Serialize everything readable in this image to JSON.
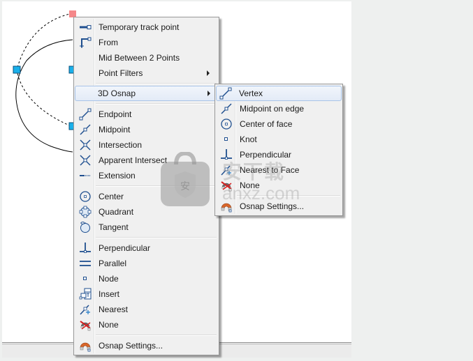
{
  "colors": {
    "menu_bg": "#f0f0f0",
    "icon_blue": "#1f4f8f",
    "grip_cyan": "#1ab0ea",
    "grip_selected": "#f5888a",
    "highlight_border": "#a8c4e8"
  },
  "main_menu": {
    "items": [
      {
        "label": "Temporary track point",
        "icon": "temporary-track-point-icon"
      },
      {
        "label": "From",
        "icon": "from-icon"
      },
      {
        "label": "Mid Between 2 Points",
        "icon": ""
      },
      {
        "label": "Point Filters",
        "icon": "",
        "submenu": true
      },
      {
        "label": "3D Osnap",
        "icon": "",
        "submenu": true,
        "highlighted": true
      },
      {
        "label": "Endpoint",
        "icon": "endpoint-icon"
      },
      {
        "label": "Midpoint",
        "icon": "midpoint-icon"
      },
      {
        "label": "Intersection",
        "icon": "intersection-icon"
      },
      {
        "label": "Apparent Intersect",
        "icon": "apparent-intersect-icon"
      },
      {
        "label": "Extension",
        "icon": "extension-icon"
      },
      {
        "label": "Center",
        "icon": "center-icon"
      },
      {
        "label": "Quadrant",
        "icon": "quadrant-icon"
      },
      {
        "label": "Tangent",
        "icon": "tangent-icon"
      },
      {
        "label": "Perpendicular",
        "icon": "perpendicular-icon"
      },
      {
        "label": "Parallel",
        "icon": "parallel-icon"
      },
      {
        "label": "Node",
        "icon": "node-icon"
      },
      {
        "label": "Insert",
        "icon": "insert-icon"
      },
      {
        "label": "Nearest",
        "icon": "nearest-icon"
      },
      {
        "label": "None",
        "icon": "none-icon"
      },
      {
        "label": "Osnap Settings...",
        "icon": "osnap-settings-icon"
      }
    ]
  },
  "submenu_3d_osnap": {
    "items": [
      {
        "label": "Vertex",
        "icon": "vertex-icon",
        "highlighted": true
      },
      {
        "label": "Midpoint on edge",
        "icon": "midpoint-on-edge-icon"
      },
      {
        "label": "Center of face",
        "icon": "center-of-face-icon"
      },
      {
        "label": "Knot",
        "icon": "knot-icon"
      },
      {
        "label": "Perpendicular",
        "icon": "perpendicular-icon"
      },
      {
        "label": "Nearest to Face",
        "icon": "nearest-to-face-icon"
      },
      {
        "label": "None",
        "icon": "none-icon"
      },
      {
        "label": "Osnap Settings...",
        "icon": "osnap-settings-icon"
      }
    ]
  },
  "watermark": {
    "text": "安下载",
    "sub": "anxz.com",
    "badge_char": "安"
  }
}
